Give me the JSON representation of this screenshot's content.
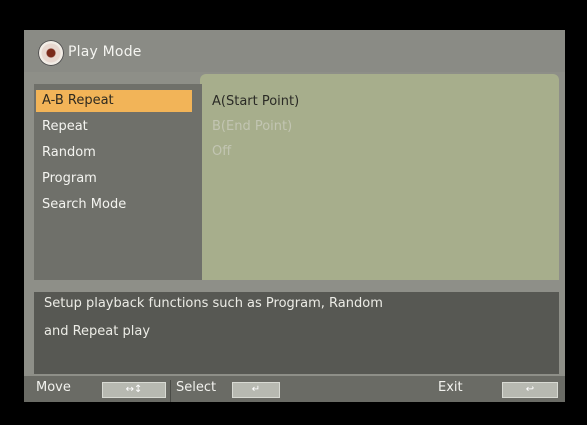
{
  "window": {
    "title": "Play Mode",
    "icon": "disc-icon"
  },
  "menu": {
    "items": [
      {
        "label": "A-B Repeat",
        "selected": true
      },
      {
        "label": "Repeat",
        "selected": false
      },
      {
        "label": "Random",
        "selected": false
      },
      {
        "label": "Program",
        "selected": false
      },
      {
        "label": "Search Mode",
        "selected": false
      }
    ]
  },
  "options": [
    {
      "label": "A(Start Point)",
      "state": "active"
    },
    {
      "label": "B(End Point)",
      "state": "disabled"
    },
    {
      "label": "Off",
      "state": "disabled"
    }
  ],
  "description": {
    "line1": "Setup playback functions such as Program, Random",
    "line2": "and Repeat play"
  },
  "bottom": {
    "move_label": "Move",
    "select_label": "Select",
    "exit_label": "Exit",
    "move_icon": "arrows-icon",
    "select_icon": "enter-icon",
    "exit_icon": "back-icon"
  },
  "colors": {
    "highlight": "#f2b458",
    "panel_bg": "#a7ae8c",
    "menu_bg": "#6f706a"
  }
}
